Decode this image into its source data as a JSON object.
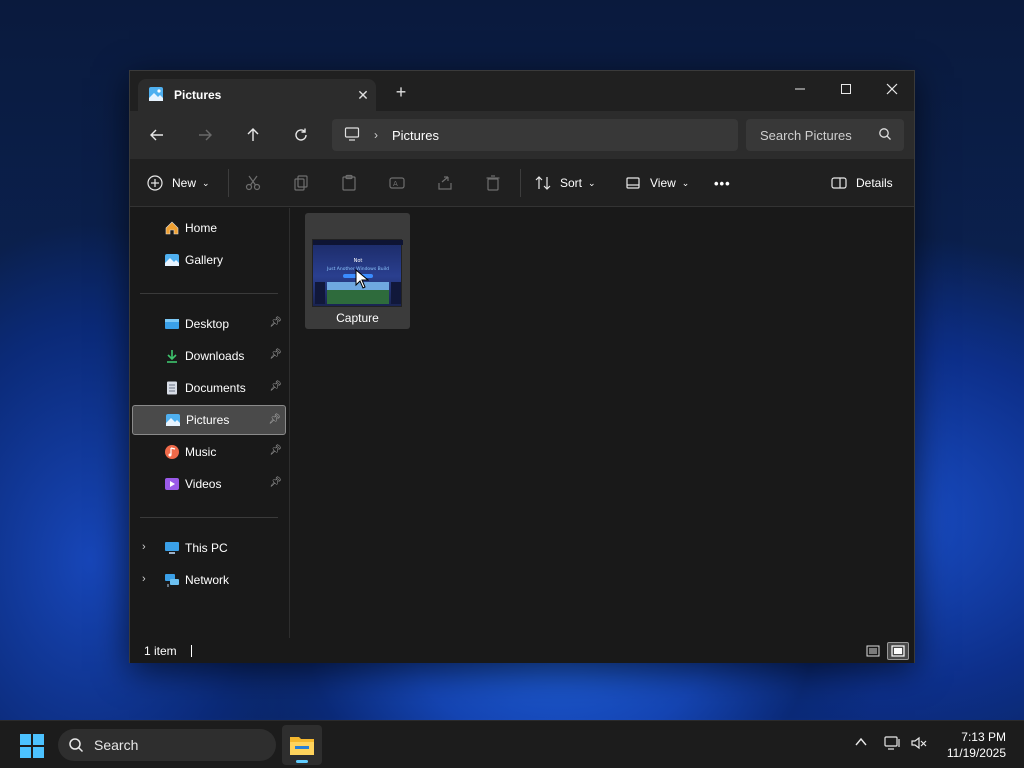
{
  "window": {
    "tab_title": "Pictures",
    "tab_close": "✕",
    "new_tab": "+"
  },
  "address_bar": {
    "location": "Pictures",
    "search_placeholder": "Search Pictures"
  },
  "toolbar": {
    "new_label": "New",
    "sort_label": "Sort",
    "view_label": "View",
    "more_label": "•••",
    "details_label": "Details"
  },
  "sidebar": {
    "quick": [
      {
        "label": "Home",
        "icon": "home-icon"
      },
      {
        "label": "Gallery",
        "icon": "gallery-icon"
      }
    ],
    "pinned": [
      {
        "label": "Desktop",
        "icon": "desktop-folder-icon"
      },
      {
        "label": "Downloads",
        "icon": "download-icon"
      },
      {
        "label": "Documents",
        "icon": "document-icon"
      },
      {
        "label": "Pictures",
        "icon": "pictures-icon",
        "selected": true
      },
      {
        "label": "Music",
        "icon": "music-icon"
      },
      {
        "label": "Videos",
        "icon": "video-icon"
      }
    ],
    "locations": [
      {
        "label": "This PC",
        "icon": "computer-icon"
      },
      {
        "label": "Network",
        "icon": "network-icon"
      }
    ]
  },
  "content": {
    "files": [
      {
        "name": "Capture",
        "type": "image"
      }
    ]
  },
  "thumbnail_text": {
    "line1": "Not",
    "line2": "Just Another Windows Build"
  },
  "status": {
    "item_count": "1 item"
  },
  "taskbar": {
    "search_label": "Search",
    "time": "7:13 PM",
    "date": "11/19/2025"
  },
  "colors": {
    "accent": "#60cdff",
    "window_bg": "#191919",
    "selected_bg": "#4a4a4a"
  }
}
